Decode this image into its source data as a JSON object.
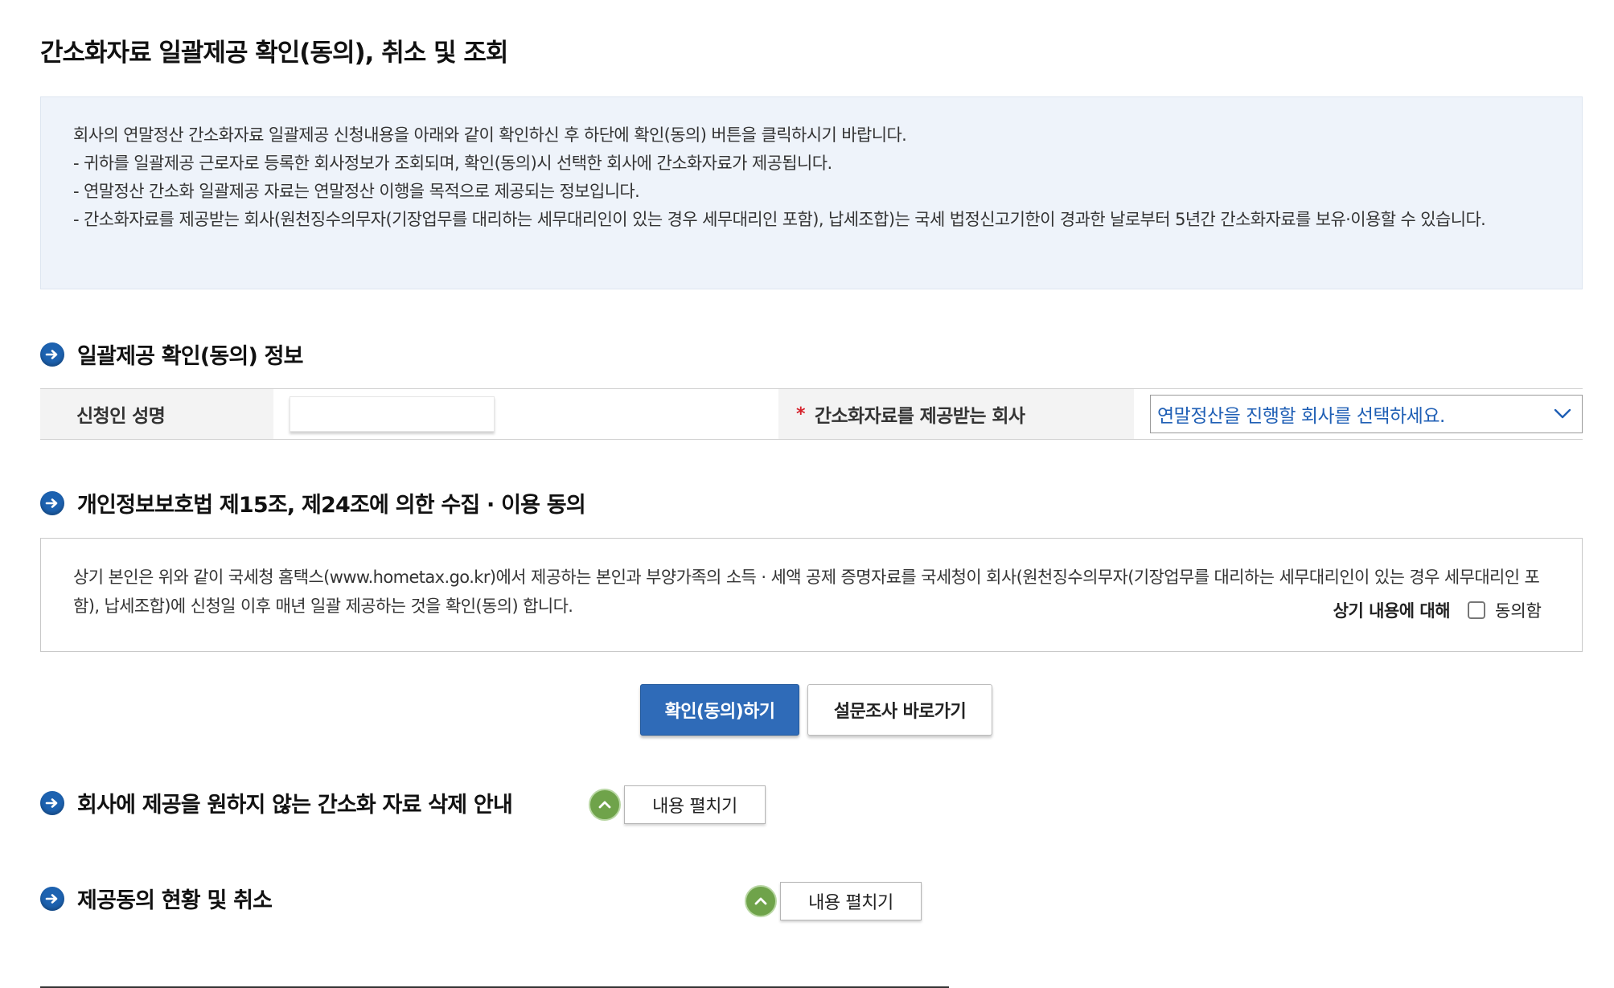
{
  "page": {
    "title": "간소화자료 일괄제공 확인(동의), 취소 및 조회"
  },
  "notice": {
    "lines": [
      "회사의 연말정산 간소화자료 일괄제공 신청내용을 아래와 같이 확인하신 후 하단에 확인(동의) 버튼을 클릭하시기 바랍니다.",
      "- 귀하를 일괄제공 근로자로 등록한 회사정보가 조회되며, 확인(동의)시 선택한 회사에 간소화자료가 제공됩니다.",
      "- 연말정산 간소화 일괄제공 자료는 연말정산 이행을 목적으로 제공되는 정보입니다.",
      "- 간소화자료를 제공받는 회사(원천징수의무자(기장업무를 대리하는 세무대리인이 있는 경우 세무대리인 포함), 납세조합)는 국세 법정신고기한이 경과한 날로부터 5년간 간소화자료를 보유·이용할 수 있습니다."
    ]
  },
  "info_section": {
    "title": "일괄제공 확인(동의) 정보",
    "applicant_label": "신청인 성명",
    "applicant_value": "",
    "required_mark": "*",
    "company_label": "간소화자료를 제공받는 회사",
    "company_select_value": "연말정산을 진행할 회사를 선택하세요."
  },
  "privacy_section": {
    "title": "개인정보보호법 제15조, 제24조에 의한 수집 · 이용 동의",
    "body": "상기 본인은 위와 같이 국세청 홈택스(www.hometax.go.kr)에서 제공하는 본인과 부양가족의 소득 · 세액 공제 증명자료를 국세청이 회사(원천징수의무자(기장업무를 대리하는 세무대리인이 있는 경우 세무대리인 포함), 납세조합)에 신청일 이후 매년 일괄 제공하는 것을 확인(동의) 합니다.",
    "agree_prefix": "상기 내용에 대해",
    "agree_label": "동의함",
    "agree_checked": false
  },
  "actions": {
    "confirm_label": "확인(동의)하기",
    "survey_label": "설문조사 바로가기"
  },
  "delete_section": {
    "title": "회사에 제공을 원하지 않는 간소화 자료 삭제 안내",
    "expand_label": "내용 펼치기"
  },
  "status_section": {
    "title": "제공동의 현황 및 취소",
    "expand_label": "내용 펼치기"
  },
  "colors": {
    "primary_button": "#2f6bb8",
    "section_icon": "#1d62b0",
    "expand_icon": "#6fa34a",
    "notice_background": "#eef3fa",
    "required_mark": "#d6212b",
    "select_text": "#1f5fb5"
  },
  "icons": {
    "section_marker": "circle-arrow-right-icon",
    "select_caret": "chevron-down-icon",
    "expand_toggle": "chevron-up-icon"
  }
}
